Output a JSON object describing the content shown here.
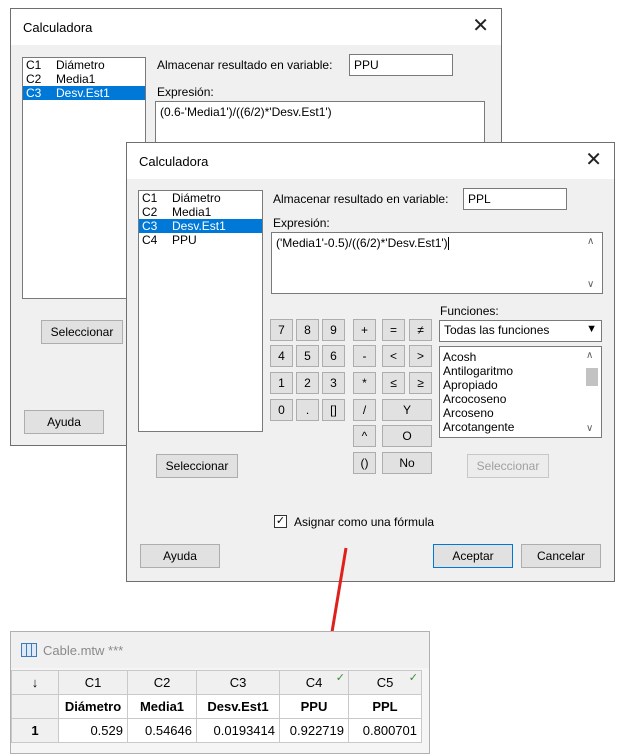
{
  "back_dialog": {
    "title": "Calculadora",
    "columns": [
      {
        "code": "C1",
        "name": "Diámetro"
      },
      {
        "code": "C2",
        "name": "Media1"
      },
      {
        "code": "C3",
        "name": "Desv.Est1"
      }
    ],
    "store_label": "Almacenar resultado en variable:",
    "store_value": "PPU",
    "expression_label": "Expresión:",
    "expression": "(0.6-'Media1')/((6/2)*'Desv.Est1')",
    "select_label": "Seleccionar",
    "help_label": "Ayuda"
  },
  "front_dialog": {
    "title": "Calculadora",
    "columns": [
      {
        "code": "C1",
        "name": "Diámetro"
      },
      {
        "code": "C2",
        "name": "Media1"
      },
      {
        "code": "C3",
        "name": "Desv.Est1"
      },
      {
        "code": "C4",
        "name": "PPU"
      }
    ],
    "store_label": "Almacenar resultado en variable:",
    "store_value": "PPL",
    "expression_label": "Expresión:",
    "expression": "('Media1'-0.5)/((6/2)*'Desv.Est1')",
    "keypad": [
      "7",
      "8",
      "9",
      "4",
      "5",
      "6",
      "1",
      "2",
      "3",
      "0",
      ".",
      "[]"
    ],
    "operators": [
      "+",
      "=",
      "≠",
      "-",
      "<",
      ">",
      "*",
      "≤",
      "≥",
      "/",
      "Y",
      "^",
      "O",
      "()",
      "No"
    ],
    "functions_label": "Funciones:",
    "functions_selected": "Todas las funciones",
    "functions": [
      "Acosh",
      "Antilogaritmo",
      "Apropiado",
      "Arcocoseno",
      "Arcoseno",
      "Arcotangente"
    ],
    "select_label": "Seleccionar",
    "select_fn_label": "Seleccionar",
    "formula_checkbox_label": "Asignar como una fórmula",
    "formula_checked": true,
    "help_label": "Ayuda",
    "ok_label": "Aceptar",
    "cancel_label": "Cancelar"
  },
  "worksheet": {
    "title": "Cable.mtw ***",
    "corner": "↓",
    "columns": [
      "C1",
      "C2",
      "C3",
      "C4",
      "C5"
    ],
    "names": [
      "Diámetro",
      "Media1",
      "Desv.Est1",
      "PPU",
      "PPL"
    ],
    "row_number": "1",
    "row": [
      "0.529",
      "0.54646",
      "0.0193414",
      "0.922719",
      "0.800701"
    ]
  },
  "colors": {
    "selection": "#0078d7",
    "arrow": "#e0201c",
    "check": "#3a8a3a"
  }
}
